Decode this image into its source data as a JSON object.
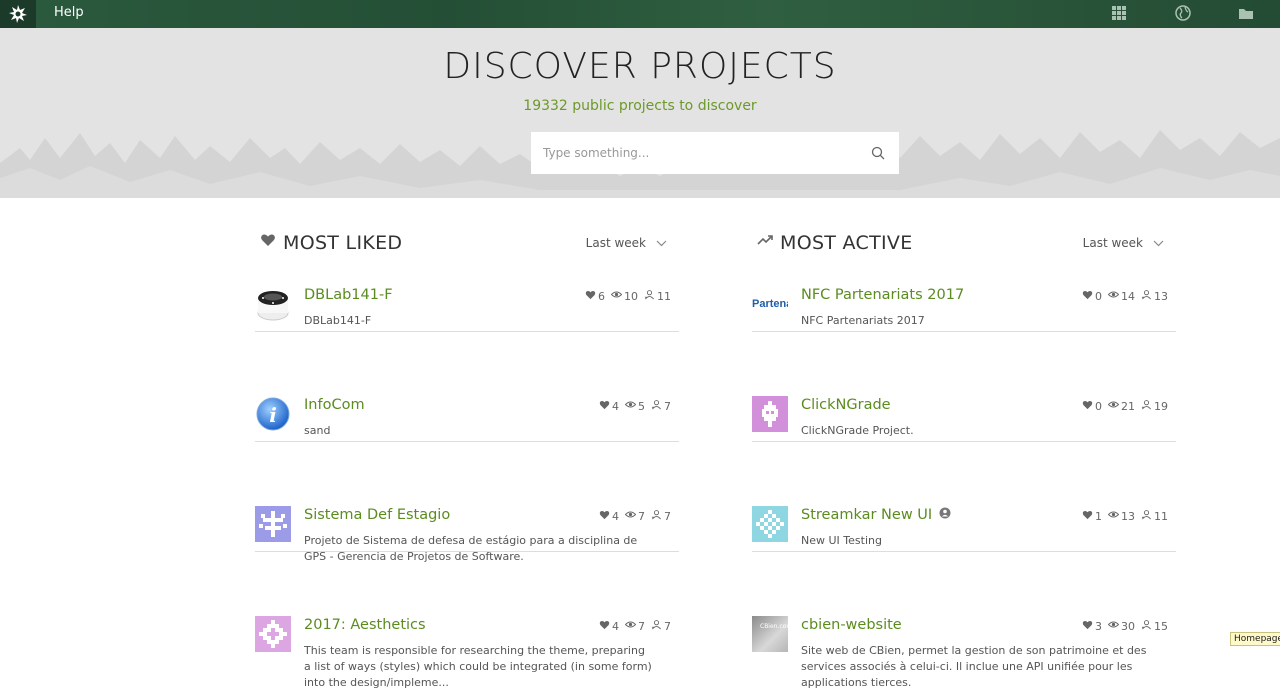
{
  "topbar": {
    "help_label": "Help",
    "icons": [
      "logo-icon",
      "apps-grid-icon",
      "globe-icon",
      "folder-icon"
    ]
  },
  "hero": {
    "title": "DISCOVER PROJECTS",
    "subtitle": "19332 public projects to discover",
    "search_placeholder": "Type something..."
  },
  "most_liked": {
    "title": "MOST LIKED",
    "period": "Last week",
    "items": [
      {
        "name": "DBLab141-F",
        "desc": "DBLab141-F",
        "likes": "6",
        "views": "10",
        "fans": "11"
      },
      {
        "name": "InfoCom",
        "desc": "sand",
        "likes": "4",
        "views": "5",
        "fans": "7"
      },
      {
        "name": "Sistema Def Estagio",
        "desc": "Projeto de Sistema de defesa de estágio para a disciplina de GPS - Gerencia de Projetos de Software.",
        "likes": "4",
        "views": "7",
        "fans": "7"
      },
      {
        "name": "2017: Aesthetics",
        "desc": "This team is responsible for researching the theme, preparing a list of ways (styles) which could be integrated (in some form) into the design/impleme...",
        "likes": "4",
        "views": "7",
        "fans": "7"
      }
    ]
  },
  "most_active": {
    "title": "MOST ACTIVE",
    "period": "Last week",
    "items": [
      {
        "name": "NFC Partenariats 2017",
        "desc": "NFC Partenariats 2017",
        "likes": "0",
        "views": "14",
        "fans": "13",
        "thumb_text": "Partena"
      },
      {
        "name": "ClickNGrade",
        "desc": "ClickNGrade Project.",
        "likes": "0",
        "views": "21",
        "fans": "19"
      },
      {
        "name": "Streamkar New UI",
        "desc": "New UI Testing",
        "likes": "1",
        "views": "13",
        "fans": "11"
      },
      {
        "name": "cbien-website",
        "desc": "Site web de CBien, permet la gestion de son patrimoine et des services associés à celui-ci. Il inclue une API unifiée pour les applications tierces.",
        "likes": "3",
        "views": "30",
        "fans": "15",
        "thumb_text": "CBien.com"
      }
    ]
  },
  "tooltip": "Homepage",
  "colors": {
    "accent": "#5b8c1f",
    "topbar": "#2b5a3e",
    "hero_bg": "#e3e3e3"
  }
}
